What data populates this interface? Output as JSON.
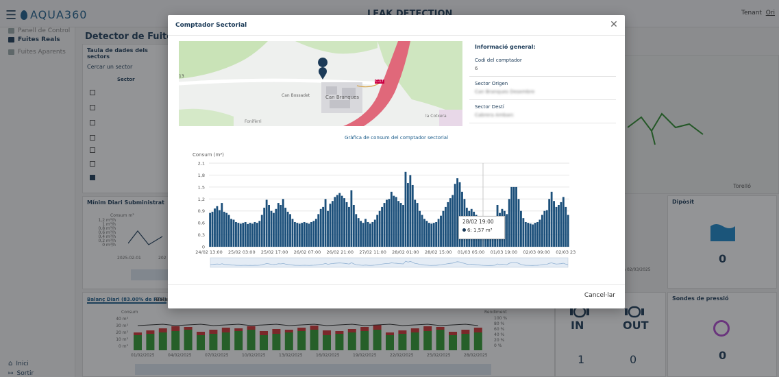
{
  "app": {
    "logo_text": "AQUA360",
    "page_title": "LEAK DETECTION",
    "tenant_label": "Tenant",
    "tenant_value": "Ori"
  },
  "sidebar": {
    "items": [
      {
        "label": "Panell de Control"
      },
      {
        "label": "Fuites Reals"
      },
      {
        "label": "Fuites Aparents"
      }
    ],
    "bottom": [
      {
        "label": "Inici"
      },
      {
        "label": "Sortir"
      }
    ]
  },
  "background": {
    "heading": "Detector de Fuites Reals a",
    "table_card_title": "Taula de dades dels sectors",
    "table_search": "Cercar un sector",
    "table_col": "Sector",
    "min_card_title": "Mínim Diari Subministrat",
    "min_ylabel": "Consum m³",
    "min_yticks": [
      "1,2 m³/h",
      "1 m³/h",
      "0,8 m³/h",
      "0,6 m³/h",
      "0,4 m³/h",
      "0,2 m³/h",
      "0 m³/h"
    ],
    "min_xtick": "2025-02-01",
    "min_xtick2": "202",
    "balance_tab": "Balanç Diari (83.00% de RTH)",
    "balance_tab2": "Balan",
    "balance_ylabel": "Consum",
    "balance_y2label": "Rendiment",
    "balance_yticks": [
      "40 m³",
      "30 m³",
      "20 m³",
      "10 m³",
      "0 m³"
    ],
    "balance_y2ticks": [
      "100 %",
      "80 %",
      "60 %",
      "40 %",
      "20 %",
      "0 %"
    ],
    "balance_dates": [
      "01/02/2025",
      "04/02/2025",
      "07/02/2025",
      "10/02/2025",
      "13/02/2025",
      "16/02/2025",
      "19/02/2025",
      "22/02/2025",
      "25/02/2025",
      "28/02/2025"
    ],
    "map_town": "Torelló",
    "deposit_title": "Dipòsit",
    "deposit_value": "0",
    "date_note": "de a 02/03/2025",
    "in_label": "IN",
    "out_label": "OUT",
    "in_value": "1",
    "out_value": "0",
    "pressure_title": "Sondes de pressió",
    "pressure_value": "0"
  },
  "modal": {
    "title": "Comptador Sectorial",
    "info_title": "Informació general:",
    "fields": [
      {
        "label": "Codi del comptador",
        "value": "6"
      },
      {
        "label": "Sector Origen",
        "value": "Can Branques Desembre"
      },
      {
        "label": "Sector Destí",
        "value": "Cabrera Ambarc"
      }
    ],
    "map_labels": {
      "place1": "Can Bossadet",
      "place2": "Can Branques",
      "place3": "Fonifèrri",
      "place4": "la Cotxera",
      "road": "C-17",
      "left": "13"
    },
    "chart_heading": "Gràfica de consum del comptador sectorial",
    "tooltip_date": "28/02 19:00",
    "tooltip_value": "6: 1,57 m³",
    "cancel": "Cancel·lar"
  },
  "chart_data": {
    "type": "bar",
    "ylabel": "Consum (m³)",
    "ylim": [
      0,
      2.1
    ],
    "yticks": [
      0,
      0.3,
      0.6,
      0.9,
      1.2,
      1.5,
      1.8,
      2.1
    ],
    "xtick_labels": [
      "24/02 13:00",
      "25/02 03:00",
      "25/02 17:00",
      "26/02 07:00",
      "26/02 21:00",
      "27/02 11:00",
      "28/02 01:00",
      "28/02 15:00",
      "01/03 05:00",
      "01/03 19:00",
      "02/03 09:00",
      "02/03 23:00"
    ],
    "series": [
      {
        "values": [
          0.85,
          0.88,
          0.96,
          1.02,
          0.92,
          1.1,
          0.88,
          0.85,
          0.8,
          0.7,
          0.68,
          0.62,
          0.6,
          0.58,
          0.6,
          0.62,
          0.57,
          0.6,
          0.58,
          0.62,
          0.6,
          0.65,
          0.8,
          0.98,
          1.18,
          1.05,
          0.9,
          0.85,
          0.95,
          1.1,
          1.05,
          1.2,
          0.98,
          0.88,
          0.82,
          0.7,
          0.62,
          0.6,
          0.58,
          0.6,
          0.62,
          0.6,
          0.58,
          0.62,
          0.65,
          0.7,
          0.82,
          0.95,
          1.0,
          1.2,
          0.9,
          1.08,
          1.15,
          1.25,
          1.3,
          1.35,
          1.28,
          1.22,
          1.12,
          1.0,
          1.42,
          1.05,
          0.82,
          0.72,
          0.65,
          0.6,
          0.7,
          0.62,
          0.58,
          0.62,
          0.68,
          0.8,
          0.9,
          1.0,
          1.1,
          1.18,
          1.2,
          1.38,
          1.28,
          1.25,
          1.15,
          1.1,
          1.05,
          1.88,
          1.6,
          1.8,
          1.55,
          1.18,
          1.1,
          0.9,
          0.8,
          0.7,
          0.65,
          0.6,
          0.58,
          0.6,
          0.62,
          0.7,
          0.78,
          0.9,
          1.0,
          1.12,
          1.22,
          1.3,
          1.58,
          1.72,
          1.62,
          1.38,
          1.2,
          0.98,
          0.9,
          0.95,
          0.88,
          0.8,
          0.72,
          0.65,
          0.6,
          0.58,
          0.55,
          0.56,
          0.58,
          0.65,
          1.05,
          0.85,
          0.95,
          0.9,
          0.82,
          1.2,
          1.5,
          1.5,
          1.5,
          1.2,
          0.9,
          0.72,
          0.62,
          0.6,
          0.58,
          0.56,
          0.6,
          0.62,
          0.68,
          0.8,
          0.9,
          0.92,
          1.2,
          1.38,
          1.15,
          1.0,
          1.05,
          1.12,
          1.25,
          1.0,
          0.8
        ]
      }
    ]
  }
}
